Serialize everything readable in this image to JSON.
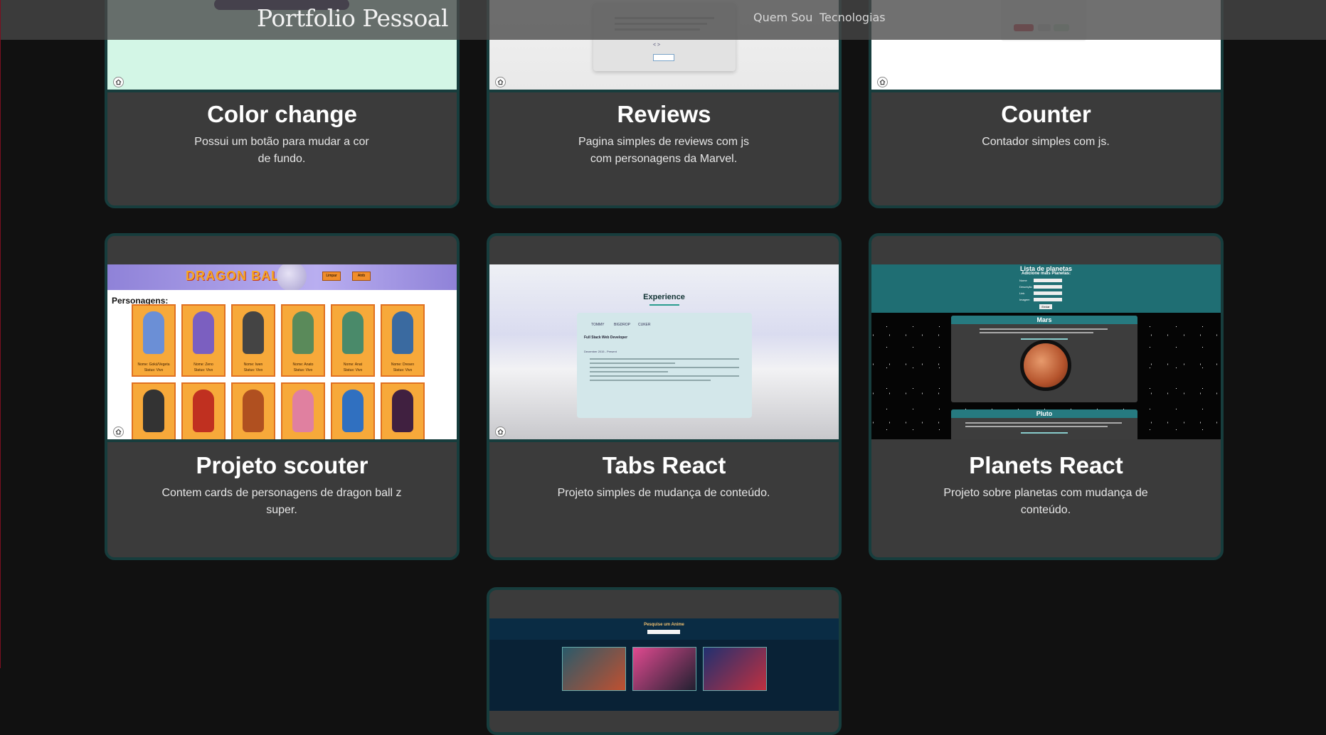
{
  "header": {
    "brand": "Portfolio Pessoal",
    "nav": [
      "Quem Sou",
      "Tecnologias"
    ]
  },
  "projects": [
    {
      "title": "Color change",
      "description": "Possui um botão para mudar a cor de fundo."
    },
    {
      "title": "Reviews",
      "description": "Pagina simples de reviews com js com personagens da Marvel."
    },
    {
      "title": "Counter",
      "description": "Contador simples com js."
    },
    {
      "title": "Projeto scouter",
      "description": "Contem cards de personagens de dragon ball z super."
    },
    {
      "title": "Tabs React",
      "description": "Projeto simples de mudança de conteúdo."
    },
    {
      "title": "Planets React",
      "description": "Projeto sobre planetas com mudança de conteúdo."
    }
  ],
  "previews": {
    "scouter": {
      "logo": "DRAGON BALL Z",
      "buttons": [
        "Limpar",
        "Atrib"
      ],
      "heading": "Personagens:",
      "cards": [
        {
          "name": "Nome: Gokú/Vegeta",
          "status": "Status: Vivo"
        },
        {
          "name": "Nome: Zeno",
          "status": "Status: Vivo"
        },
        {
          "name": "Nome: Iwen",
          "status": "Status: Vivo"
        },
        {
          "name": "Nome: Anato",
          "status": "Status: Vivo"
        },
        {
          "name": "Nome: Anat",
          "status": "Status: Vivo"
        },
        {
          "name": "Nome: Dresen",
          "status": "Status: Vivo"
        }
      ]
    },
    "tabs": {
      "heading": "Experience",
      "tabs": [
        "TOMMY",
        "BIGDROP",
        "CUKER"
      ],
      "job": "Full Stack Web Developer",
      "date": "December 2015 - Present"
    },
    "planets": {
      "heading": "Lista de planetas",
      "subheading": "Adicione mais Planetas:",
      "fields": [
        "Nome",
        "Descrição",
        "Link",
        "Imagem"
      ],
      "submit": "Enviar",
      "items": [
        "Mars",
        "Pluto"
      ]
    },
    "anime": {
      "heading": "Pesquise um Anime"
    }
  },
  "colors": {
    "page_bg": "#111111",
    "card_bg": "#3b3b3b",
    "card_border": "#173d3d"
  }
}
